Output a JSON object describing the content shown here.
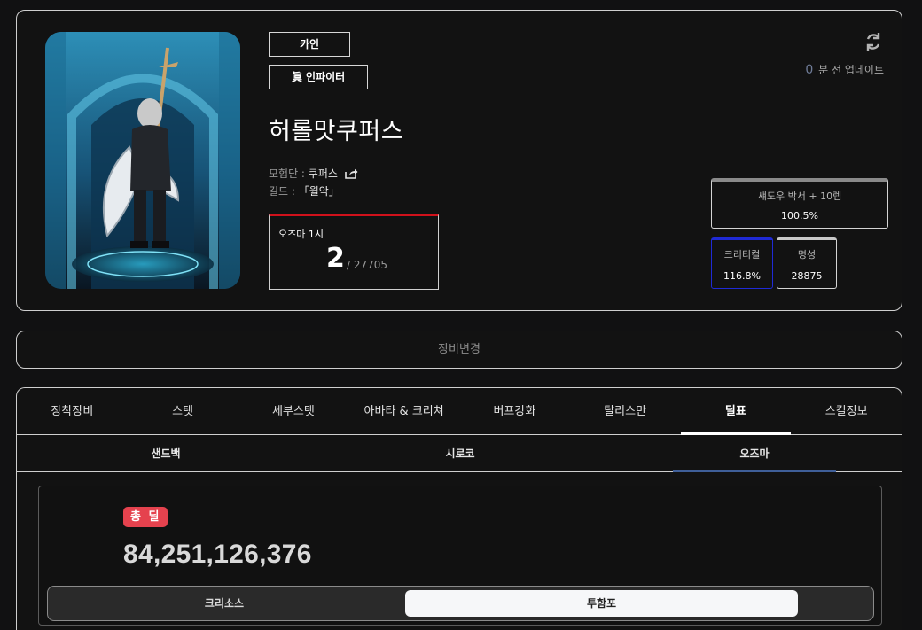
{
  "profile": {
    "server": "카인",
    "job": "眞 인파이터",
    "name": "허롤맛쿠퍼스",
    "adventure_label": "모험단 : ",
    "adventure_value": "쿠퍼스",
    "guild_label": "길드 : ",
    "guild_value": "「월악」",
    "rank": {
      "label": "오즈마 1시",
      "position": "2",
      "total": "/ 27705",
      "accent": "#d0111b"
    },
    "update": {
      "minutes": "0",
      "text": "분 전 업데이트"
    },
    "stats": {
      "buff_label": "섀도우 박서 + 10렙",
      "buff_value": "100.5%",
      "crit_label": "크리티컬",
      "crit_value": "116.8%",
      "fame_label": "명성",
      "fame_value": "28875"
    },
    "icons": {
      "refresh": "refresh-icon",
      "share": "share-icon"
    }
  },
  "equip_change": {
    "label": "장비변경"
  },
  "tabs": [
    {
      "label": "장착장비"
    },
    {
      "label": "스탯"
    },
    {
      "label": "세부스탯"
    },
    {
      "label": "아바타 & 크리쳐"
    },
    {
      "label": "버프강화"
    },
    {
      "label": "탈리스만"
    },
    {
      "label": "딜표"
    },
    {
      "label": "스킬정보"
    }
  ],
  "active_tab": "딜표",
  "sub_tabs": [
    {
      "label": "샌드백"
    },
    {
      "label": "시로코"
    },
    {
      "label": "오즈마"
    }
  ],
  "active_sub_tab": "오즈마",
  "damage": {
    "badge": "총 딜",
    "total": "84,251,126,376",
    "badge_color": "#e5424e"
  },
  "segments": [
    {
      "label": "크리소스"
    },
    {
      "label": "투함포"
    }
  ],
  "active_segment": "투함포"
}
